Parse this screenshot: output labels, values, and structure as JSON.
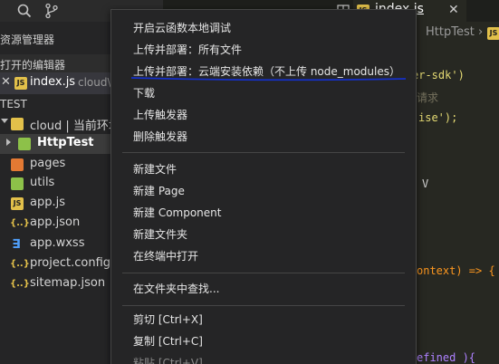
{
  "sidebar": {
    "explorer_title": "资源管理器",
    "open_editors_title": "打开的编辑器",
    "open_editor": {
      "close": "✕",
      "filename": "index.js",
      "path": "cloud\\"
    },
    "project_title": "TEST",
    "tree": [
      {
        "label": "cloud | 当前环境",
        "kind": "folder-cloud"
      },
      {
        "label": "HttpTest",
        "kind": "folder-green"
      },
      {
        "label": "pages",
        "kind": "folder-orange"
      },
      {
        "label": "utils",
        "kind": "folder-green"
      },
      {
        "label": "app.js",
        "kind": "js"
      },
      {
        "label": "app.json",
        "kind": "json"
      },
      {
        "label": "app.wxss",
        "kind": "wxss"
      },
      {
        "label": "project.config.json",
        "kind": "json"
      },
      {
        "label": "sitemap.json",
        "kind": "json"
      }
    ]
  },
  "editor": {
    "tab_label": "index.js",
    "tab_close": "✕",
    "breadcrumb": "HttpTest ›",
    "code_fragments": [
      "er-sdk')",
      "请求",
      "ise');",
      "V",
      "ontext) => {",
      "efined ){"
    ]
  },
  "menu": {
    "items": [
      {
        "label": "开启云函数本地调试"
      },
      {
        "label": "上传并部署：所有文件"
      },
      {
        "label": "上传并部署：云端安装依赖（不上传 node_modules）",
        "highlighted": true
      },
      {
        "label": "下载"
      },
      {
        "label": "上传触发器"
      },
      {
        "label": "删除触发器"
      },
      {
        "label": "新建文件"
      },
      {
        "label": "新建 Page"
      },
      {
        "label": "新建 Component"
      },
      {
        "label": "新建文件夹"
      },
      {
        "label": "在终端中打开"
      },
      {
        "label": "在文件夹中查找..."
      },
      {
        "label": "剪切  [Ctrl+X]"
      },
      {
        "label": "复制  [Ctrl+C]"
      },
      {
        "label": "粘贴  [Ctrl+V]",
        "disabled": true
      }
    ]
  },
  "colors": {
    "accent_underline": "#1530c8",
    "string": "#e6db74",
    "keyword": "#f92672",
    "folder_green": "#8dc149",
    "folder_orange": "#e37933",
    "folder_cloud": "#e2c04a",
    "js_icon": "#e2c04a",
    "wxss_icon": "#4f9df7"
  },
  "icons": [
    "search-icon",
    "source-control-icon",
    "split-editor-icon",
    "js-file-icon",
    "json-file-icon",
    "wxss-file-icon",
    "folder-icon"
  ]
}
